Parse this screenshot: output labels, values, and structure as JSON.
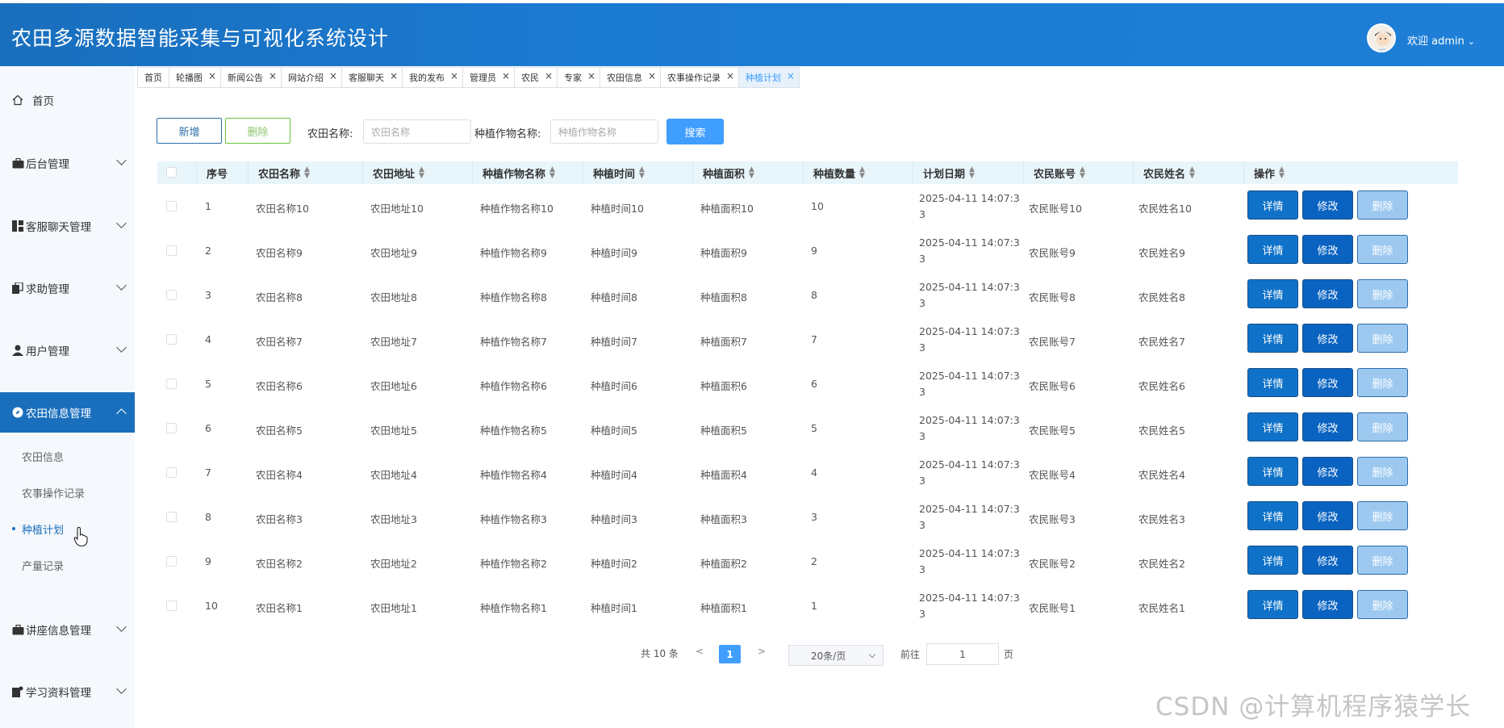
{
  "app": {
    "title": "农田多源数据智能采集与可视化系统设计",
    "welcome": "欢迎 admin"
  },
  "sidebar": {
    "home": "首页",
    "menus": [
      {
        "label": "后台管理"
      },
      {
        "label": "客服聊天管理"
      },
      {
        "label": "求助管理"
      },
      {
        "label": "用户管理"
      },
      {
        "label": "农田信息管理"
      },
      {
        "label": "讲座信息管理"
      },
      {
        "label": "学习资料管理"
      }
    ],
    "submenu": [
      "农田信息",
      "农事操作记录",
      "种植计划",
      "产量记录"
    ]
  },
  "tabs": [
    "首页",
    "轮播图",
    "新闻公告",
    "网站介绍",
    "客服聊天",
    "我的发布",
    "管理员",
    "农民",
    "专家",
    "农田信息",
    "农事操作记录",
    "种植计划"
  ],
  "toolbar": {
    "add": "新增",
    "delete": "删除",
    "field_name_label": "农田名称:",
    "field_name_placeholder": "农田名称",
    "crop_name_label": "种植作物名称:",
    "crop_name_placeholder": "种植作物名称",
    "search": "搜索"
  },
  "table": {
    "columns": [
      "序号",
      "农田名称",
      "农田地址",
      "种植作物名称",
      "种植时间",
      "种植面积",
      "种植数量",
      "计划日期",
      "农民账号",
      "农民姓名",
      "操作"
    ],
    "rows": [
      {
        "no": "1",
        "name": "农田名称10",
        "addr": "农田地址10",
        "crop": "种植作物名称10",
        "time": "种植时间10",
        "area": "种植面积10",
        "qty": "10",
        "date1": "2025-04-11 14:07:3",
        "date2": "3",
        "acct": "农民账号10",
        "farmer": "农民姓名10"
      },
      {
        "no": "2",
        "name": "农田名称9",
        "addr": "农田地址9",
        "crop": "种植作物名称9",
        "time": "种植时间9",
        "area": "种植面积9",
        "qty": "9",
        "date1": "2025-04-11 14:07:3",
        "date2": "3",
        "acct": "农民账号9",
        "farmer": "农民姓名9"
      },
      {
        "no": "3",
        "name": "农田名称8",
        "addr": "农田地址8",
        "crop": "种植作物名称8",
        "time": "种植时间8",
        "area": "种植面积8",
        "qty": "8",
        "date1": "2025-04-11 14:07:3",
        "date2": "3",
        "acct": "农民账号8",
        "farmer": "农民姓名8"
      },
      {
        "no": "4",
        "name": "农田名称7",
        "addr": "农田地址7",
        "crop": "种植作物名称7",
        "time": "种植时间7",
        "area": "种植面积7",
        "qty": "7",
        "date1": "2025-04-11 14:07:3",
        "date2": "3",
        "acct": "农民账号7",
        "farmer": "农民姓名7"
      },
      {
        "no": "5",
        "name": "农田名称6",
        "addr": "农田地址6",
        "crop": "种植作物名称6",
        "time": "种植时间6",
        "area": "种植面积6",
        "qty": "6",
        "date1": "2025-04-11 14:07:3",
        "date2": "3",
        "acct": "农民账号6",
        "farmer": "农民姓名6"
      },
      {
        "no": "6",
        "name": "农田名称5",
        "addr": "农田地址5",
        "crop": "种植作物名称5",
        "time": "种植时间5",
        "area": "种植面积5",
        "qty": "5",
        "date1": "2025-04-11 14:07:3",
        "date2": "3",
        "acct": "农民账号5",
        "farmer": "农民姓名5"
      },
      {
        "no": "7",
        "name": "农田名称4",
        "addr": "农田地址4",
        "crop": "种植作物名称4",
        "time": "种植时间4",
        "area": "种植面积4",
        "qty": "4",
        "date1": "2025-04-11 14:07:3",
        "date2": "3",
        "acct": "农民账号4",
        "farmer": "农民姓名4"
      },
      {
        "no": "8",
        "name": "农田名称3",
        "addr": "农田地址3",
        "crop": "种植作物名称3",
        "time": "种植时间3",
        "area": "种植面积3",
        "qty": "3",
        "date1": "2025-04-11 14:07:3",
        "date2": "3",
        "acct": "农民账号3",
        "farmer": "农民姓名3"
      },
      {
        "no": "9",
        "name": "农田名称2",
        "addr": "农田地址2",
        "crop": "种植作物名称2",
        "time": "种植时间2",
        "area": "种植面积2",
        "qty": "2",
        "date1": "2025-04-11 14:07:3",
        "date2": "3",
        "acct": "农民账号2",
        "farmer": "农民姓名2"
      },
      {
        "no": "10",
        "name": "农田名称1",
        "addr": "农田地址1",
        "crop": "种植作物名称1",
        "time": "种植时间1",
        "area": "种植面积1",
        "qty": "1",
        "date1": "2025-04-11 14:07:3",
        "date2": "3",
        "acct": "农民账号1",
        "farmer": "农民姓名1"
      }
    ],
    "actions": {
      "detail": "详情",
      "edit": "修改",
      "delete": "删除"
    }
  },
  "pagination": {
    "total": "共 10 条",
    "prev": "<",
    "current": "1",
    "next": ">",
    "page_size": "20条/页",
    "goto_label": "前往",
    "goto_value": "1",
    "page_suffix": "页"
  },
  "watermark": "CSDN @计算机程序猿学长",
  "colors": {
    "header": "#1a6fbd",
    "accent": "#409eff",
    "action_detail": "#0f72c8",
    "action_edit": "#0a63c1",
    "action_delete": "#9dc9f0"
  }
}
